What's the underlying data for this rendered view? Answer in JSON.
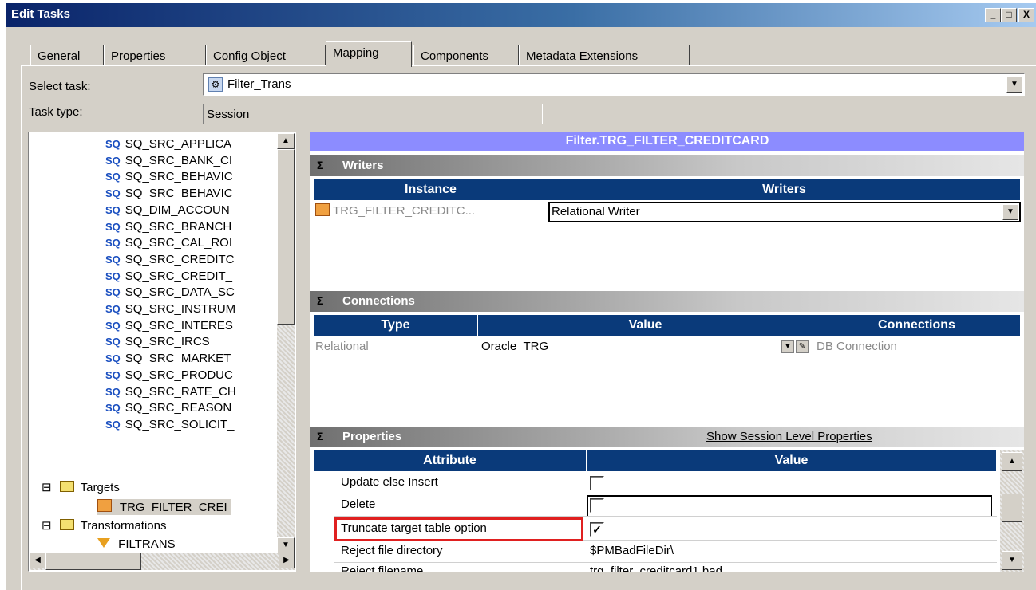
{
  "window": {
    "title": "Edit Tasks",
    "minimize": "_",
    "maximize": "□",
    "close": "X"
  },
  "tabs": [
    {
      "label": "General"
    },
    {
      "label": "Properties"
    },
    {
      "label": "Config Object"
    },
    {
      "label": "Mapping"
    },
    {
      "label": "Components"
    },
    {
      "label": "Metadata Extensions"
    }
  ],
  "active_tab": "Mapping",
  "select_task": {
    "label": "Select task:",
    "value": "Filter_Trans"
  },
  "task_type": {
    "label": "Task type:",
    "value": "Session"
  },
  "tree": {
    "sources": [
      "SQ_SRC_APPLICA",
      "SQ_SRC_BANK_CI",
      "SQ_SRC_BEHAVIC",
      "SQ_SRC_BEHAVIC",
      "SQ_DIM_ACCOUN",
      "SQ_SRC_BRANCH",
      "SQ_SRC_CAL_ROI",
      "SQ_SRC_CREDITC",
      "SQ_SRC_CREDIT_",
      "SQ_SRC_DATA_SC",
      "SQ_SRC_INSTRUM",
      "SQ_SRC_INTERES",
      "SQ_SRC_IRCS",
      "SQ_SRC_MARKET_",
      "SQ_SRC_PRODUC",
      "SQ_SRC_RATE_CH",
      "SQ_SRC_REASON",
      "SQ_SRC_SOLICIT_"
    ],
    "sq_prefix": "SQ",
    "targets_label": "Targets",
    "target_item": "TRG_FILTER_CREI",
    "transformations_label": "Transformations",
    "transformation_item": "FILTRANS",
    "expander": "⊟"
  },
  "detail": {
    "title": "Filter.TRG_FILTER_CREDITCARD",
    "writers": {
      "section": "Writers",
      "columns": [
        "Instance",
        "Writers"
      ],
      "row": {
        "instance": "TRG_FILTER_CREDITC...",
        "writer": "Relational Writer"
      }
    },
    "connections": {
      "section": "Connections",
      "columns": [
        "Type",
        "Value",
        "Connections"
      ],
      "row": {
        "type": "Relational",
        "value": "Oracle_TRG",
        "connection": "DB Connection"
      }
    },
    "properties": {
      "section": "Properties",
      "show_link": "Show Session Level Properties",
      "columns": [
        "Attribute",
        "Value"
      ],
      "rows": [
        {
          "attribute": "Update else Insert",
          "value": "",
          "checked": false
        },
        {
          "attribute": "Delete",
          "value": "",
          "checked": false
        },
        {
          "attribute": "Truncate target table option",
          "value": "",
          "checked": true
        },
        {
          "attribute": "Reject file directory",
          "value": "$PMBadFileDir\\"
        },
        {
          "attribute": "Reject filename",
          "value": "trg_filter_creditcard1.bad"
        }
      ]
    },
    "collapse_symbol": "Σ"
  },
  "colors": {
    "accent_title": "#8c8cff",
    "grid_header": "#0a3a7a",
    "highlight": "#e02020"
  }
}
